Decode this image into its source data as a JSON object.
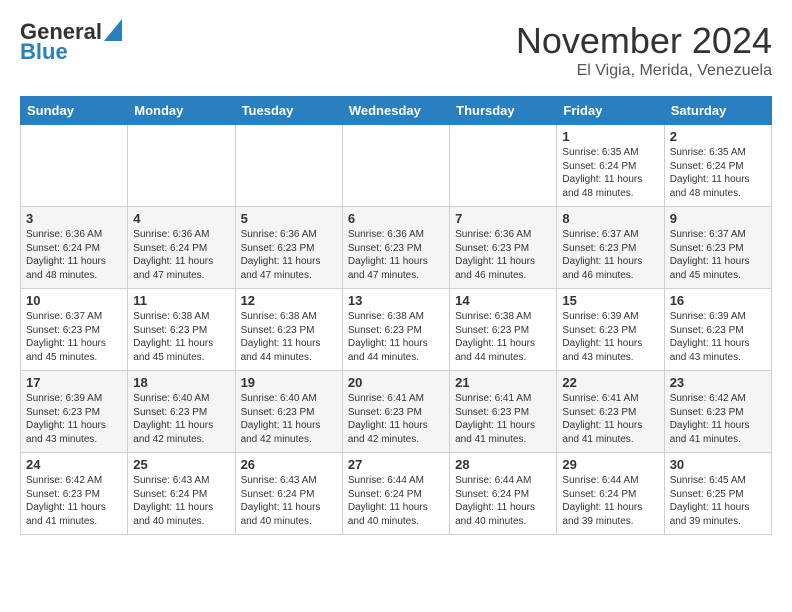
{
  "header": {
    "logo_line1": "General",
    "logo_line2": "Blue",
    "month": "November 2024",
    "location": "El Vigia, Merida, Venezuela"
  },
  "weekdays": [
    "Sunday",
    "Monday",
    "Tuesday",
    "Wednesday",
    "Thursday",
    "Friday",
    "Saturday"
  ],
  "weeks": [
    [
      {
        "day": "",
        "info": ""
      },
      {
        "day": "",
        "info": ""
      },
      {
        "day": "",
        "info": ""
      },
      {
        "day": "",
        "info": ""
      },
      {
        "day": "",
        "info": ""
      },
      {
        "day": "1",
        "info": "Sunrise: 6:35 AM\nSunset: 6:24 PM\nDaylight: 11 hours\nand 48 minutes."
      },
      {
        "day": "2",
        "info": "Sunrise: 6:35 AM\nSunset: 6:24 PM\nDaylight: 11 hours\nand 48 minutes."
      }
    ],
    [
      {
        "day": "3",
        "info": "Sunrise: 6:36 AM\nSunset: 6:24 PM\nDaylight: 11 hours\nand 48 minutes."
      },
      {
        "day": "4",
        "info": "Sunrise: 6:36 AM\nSunset: 6:24 PM\nDaylight: 11 hours\nand 47 minutes."
      },
      {
        "day": "5",
        "info": "Sunrise: 6:36 AM\nSunset: 6:23 PM\nDaylight: 11 hours\nand 47 minutes."
      },
      {
        "day": "6",
        "info": "Sunrise: 6:36 AM\nSunset: 6:23 PM\nDaylight: 11 hours\nand 47 minutes."
      },
      {
        "day": "7",
        "info": "Sunrise: 6:36 AM\nSunset: 6:23 PM\nDaylight: 11 hours\nand 46 minutes."
      },
      {
        "day": "8",
        "info": "Sunrise: 6:37 AM\nSunset: 6:23 PM\nDaylight: 11 hours\nand 46 minutes."
      },
      {
        "day": "9",
        "info": "Sunrise: 6:37 AM\nSunset: 6:23 PM\nDaylight: 11 hours\nand 45 minutes."
      }
    ],
    [
      {
        "day": "10",
        "info": "Sunrise: 6:37 AM\nSunset: 6:23 PM\nDaylight: 11 hours\nand 45 minutes."
      },
      {
        "day": "11",
        "info": "Sunrise: 6:38 AM\nSunset: 6:23 PM\nDaylight: 11 hours\nand 45 minutes."
      },
      {
        "day": "12",
        "info": "Sunrise: 6:38 AM\nSunset: 6:23 PM\nDaylight: 11 hours\nand 44 minutes."
      },
      {
        "day": "13",
        "info": "Sunrise: 6:38 AM\nSunset: 6:23 PM\nDaylight: 11 hours\nand 44 minutes."
      },
      {
        "day": "14",
        "info": "Sunrise: 6:38 AM\nSunset: 6:23 PM\nDaylight: 11 hours\nand 44 minutes."
      },
      {
        "day": "15",
        "info": "Sunrise: 6:39 AM\nSunset: 6:23 PM\nDaylight: 11 hours\nand 43 minutes."
      },
      {
        "day": "16",
        "info": "Sunrise: 6:39 AM\nSunset: 6:23 PM\nDaylight: 11 hours\nand 43 minutes."
      }
    ],
    [
      {
        "day": "17",
        "info": "Sunrise: 6:39 AM\nSunset: 6:23 PM\nDaylight: 11 hours\nand 43 minutes."
      },
      {
        "day": "18",
        "info": "Sunrise: 6:40 AM\nSunset: 6:23 PM\nDaylight: 11 hours\nand 42 minutes."
      },
      {
        "day": "19",
        "info": "Sunrise: 6:40 AM\nSunset: 6:23 PM\nDaylight: 11 hours\nand 42 minutes."
      },
      {
        "day": "20",
        "info": "Sunrise: 6:41 AM\nSunset: 6:23 PM\nDaylight: 11 hours\nand 42 minutes."
      },
      {
        "day": "21",
        "info": "Sunrise: 6:41 AM\nSunset: 6:23 PM\nDaylight: 11 hours\nand 41 minutes."
      },
      {
        "day": "22",
        "info": "Sunrise: 6:41 AM\nSunset: 6:23 PM\nDaylight: 11 hours\nand 41 minutes."
      },
      {
        "day": "23",
        "info": "Sunrise: 6:42 AM\nSunset: 6:23 PM\nDaylight: 11 hours\nand 41 minutes."
      }
    ],
    [
      {
        "day": "24",
        "info": "Sunrise: 6:42 AM\nSunset: 6:23 PM\nDaylight: 11 hours\nand 41 minutes."
      },
      {
        "day": "25",
        "info": "Sunrise: 6:43 AM\nSunset: 6:24 PM\nDaylight: 11 hours\nand 40 minutes."
      },
      {
        "day": "26",
        "info": "Sunrise: 6:43 AM\nSunset: 6:24 PM\nDaylight: 11 hours\nand 40 minutes."
      },
      {
        "day": "27",
        "info": "Sunrise: 6:44 AM\nSunset: 6:24 PM\nDaylight: 11 hours\nand 40 minutes."
      },
      {
        "day": "28",
        "info": "Sunrise: 6:44 AM\nSunset: 6:24 PM\nDaylight: 11 hours\nand 40 minutes."
      },
      {
        "day": "29",
        "info": "Sunrise: 6:44 AM\nSunset: 6:24 PM\nDaylight: 11 hours\nand 39 minutes."
      },
      {
        "day": "30",
        "info": "Sunrise: 6:45 AM\nSunset: 6:25 PM\nDaylight: 11 hours\nand 39 minutes."
      }
    ]
  ]
}
